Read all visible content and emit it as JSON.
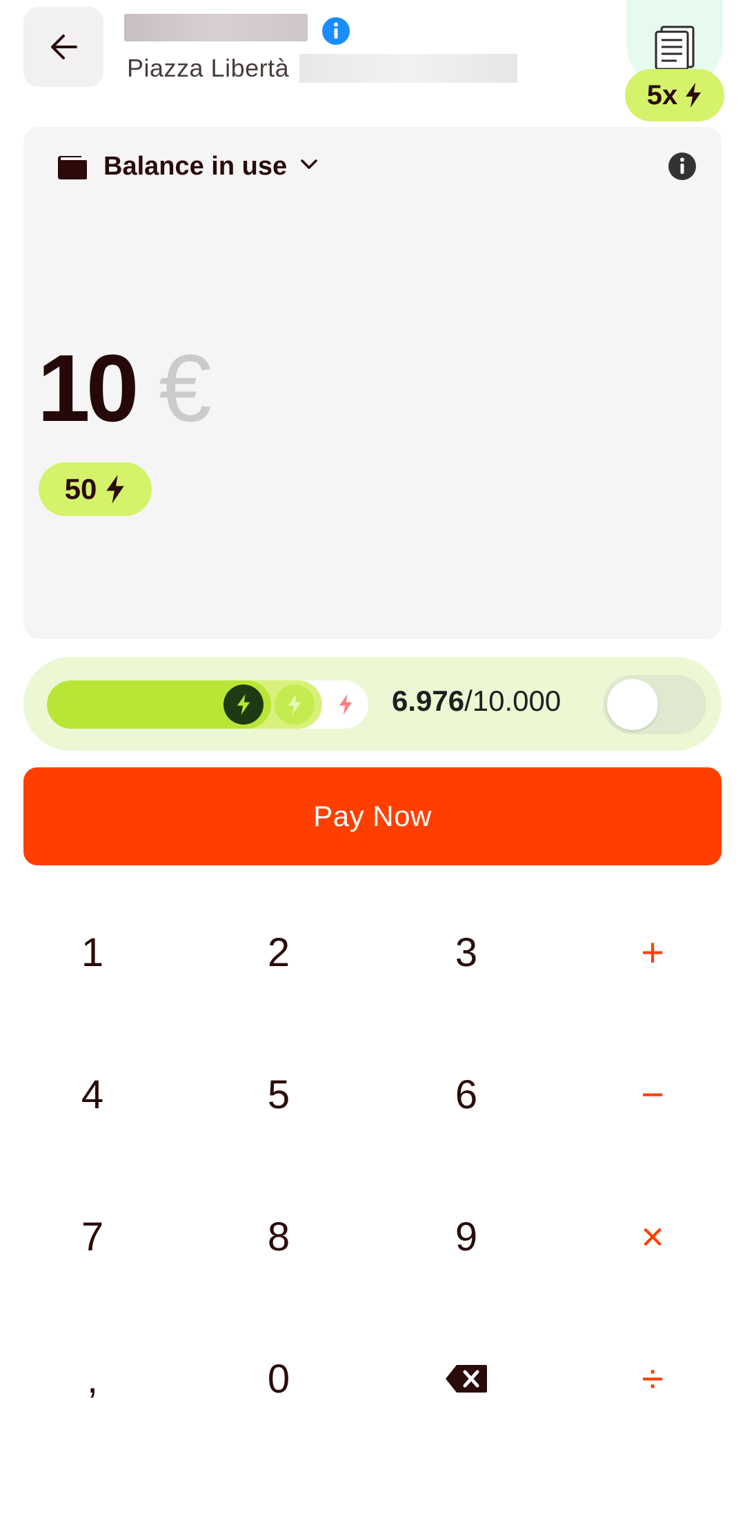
{
  "header": {
    "back_icon": "arrow-left-icon",
    "merchant_name_redacted": true,
    "merchant_address": "Piazza Libertà",
    "multiplier_badge": "5x",
    "receipt_icon": "receipt-icon"
  },
  "balance_card": {
    "label": "Balance in use",
    "amount": "10",
    "currency": "€",
    "points": "50"
  },
  "progress": {
    "current": "6.976",
    "total": "/10.000",
    "fill_fraction": 0.6976,
    "toggle_on": false
  },
  "pay_button": {
    "label": "Pay Now"
  },
  "keypad": {
    "k1": "1",
    "k2": "2",
    "k3": "3",
    "plus": "+",
    "k4": "4",
    "k5": "5",
    "k6": "6",
    "minus": "−",
    "k7": "7",
    "k8": "8",
    "k9": "9",
    "times": "×",
    "comma": ",",
    "k0": "0",
    "divide": "÷"
  },
  "colors": {
    "accent": "#ff3f00",
    "lime": "#d4f26a",
    "progress_fill": "#b9e636",
    "text_dark": "#2b0a0a",
    "card_bg": "#f5f5f5"
  }
}
